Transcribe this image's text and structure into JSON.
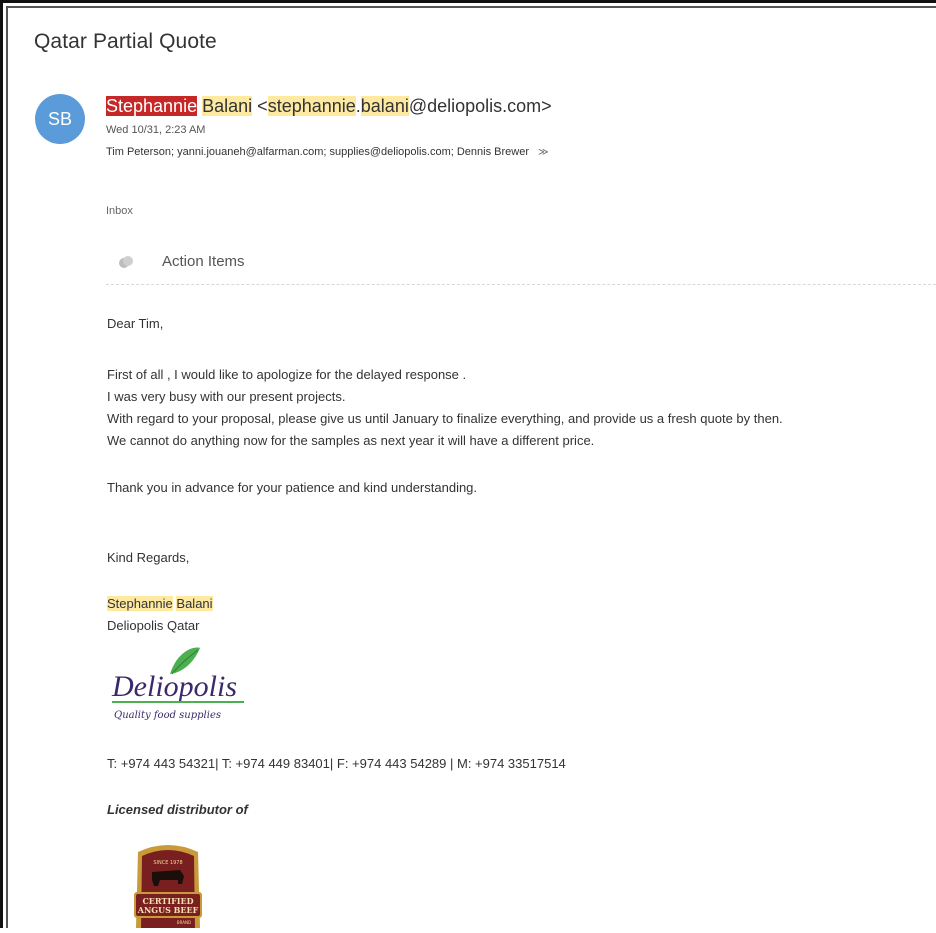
{
  "email": {
    "subject": "Qatar Partial Quote",
    "sender_initials": "SB",
    "sender_first": "Stephannie",
    "sender_last": "Balani",
    "sender_email_open": "<",
    "sender_email_user1": "stephannie",
    "sender_email_dot": ".",
    "sender_email_user2": "balani",
    "sender_email_domain": "@deliopolis.com>",
    "date": "Wed 10/31, 2:23 AM",
    "recipients": "Tim Peterson;  yanni.jouaneh@alfarman.com;  supplies@deliopolis.com;  Dennis Brewer",
    "expand_glyph": "≫",
    "folder": "Inbox",
    "action_items_label": "Action Items"
  },
  "body": {
    "greeting": "Dear Tim,",
    "paragraph1": [
      "First of all , I would like to apologize for the delayed response .",
      "I was very busy with our present projects.",
      "With regard to your proposal, please give us until January to finalize everything, and provide us a fresh quote by then.",
      "We cannot do anything now for the samples as next year it will have a different price."
    ],
    "thanks": "Thank you in advance for your patience and kind understanding.",
    "closing": "Kind  Regards,",
    "sig_first": "Stephannie",
    "sig_last": "Balani",
    "company": "Deliopolis Qatar",
    "logo_name": "Deliopolis",
    "logo_tagline": "Quality food supplies",
    "phones": "T:  +974 443 54321| T: +974 449 83401| F:  +974 443 54289 | M: +974 33517514",
    "licensed": "Licensed distributor of",
    "badge_top": "SINCE 1978",
    "badge_line1": "CERTIFIED",
    "badge_line2": "ANGUS BEEF",
    "badge_brand": "BRAND"
  },
  "colors": {
    "avatar": "#5b9bd9",
    "highlight": "#fde9a0",
    "highlight_red": "#c62828",
    "logo_green": "#4caf50",
    "logo_purple": "#3b2a6b",
    "badge_maroon": "#7a1f1f",
    "badge_gold": "#c99a3a"
  }
}
